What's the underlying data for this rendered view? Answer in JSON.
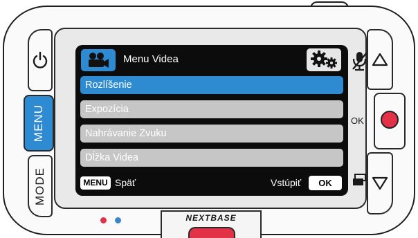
{
  "device": {
    "brand": "NEXTBASE",
    "buttons": {
      "menu_label": "MENU",
      "mode_label": "MODE",
      "ok_label": "OK"
    },
    "icons": {
      "power": "power-icon",
      "up": "triangle-up-icon",
      "down": "triangle-down-icon",
      "record": "record-dot-icon",
      "mic": "mic-muted-icon",
      "screen_toggle": "screen-toggle-icon"
    },
    "colors": {
      "accent": "#2f8bd1",
      "record": "#e23248",
      "led_blue": "#3b86c8"
    }
  },
  "screen": {
    "title": "Menu Videa",
    "header_icon": "video-camera-icon",
    "settings_icon": "gears-icon",
    "menu_items": [
      {
        "label": "Rozlíšenie",
        "selected": true
      },
      {
        "label": "Expozícia",
        "selected": false
      },
      {
        "label": "Nahrávanie Zvuku",
        "selected": false
      },
      {
        "label": "Dĺžka Videa",
        "selected": false
      }
    ],
    "footer": {
      "back_key": "MENU",
      "back_label": "Späť",
      "enter_label": "Vstúpiť",
      "enter_key": "OK"
    }
  }
}
